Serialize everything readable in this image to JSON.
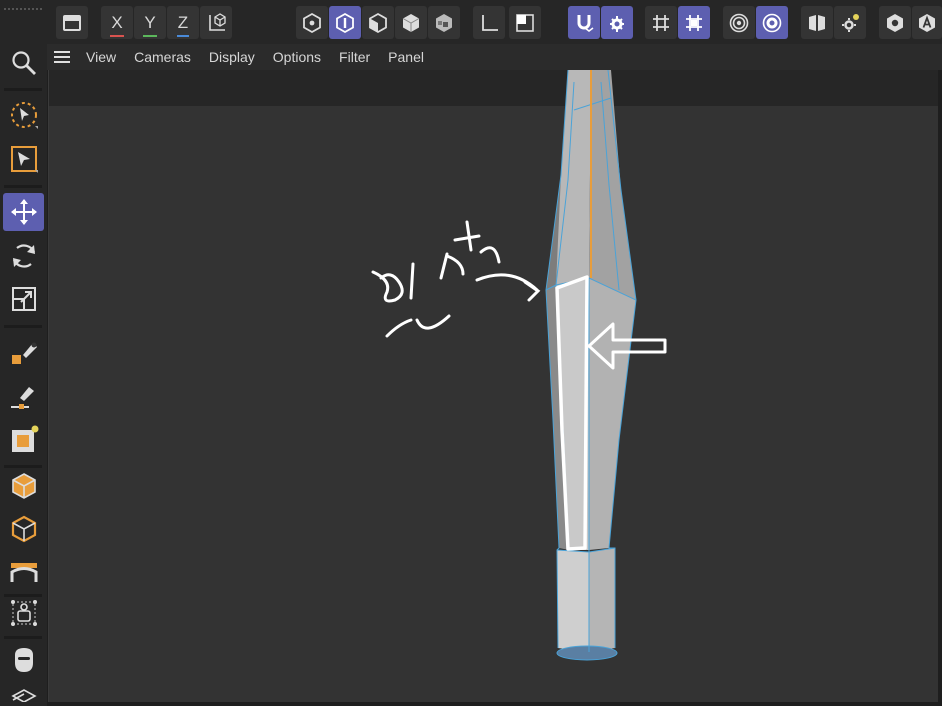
{
  "menu": {
    "items": [
      "View",
      "Cameras",
      "Display",
      "Options",
      "Filter",
      "Panel"
    ]
  },
  "toolbar": {
    "axis_x": "X",
    "axis_y": "Y",
    "axis_z": "Z",
    "icons": [
      "render-view-icon",
      "lock-x-icon",
      "lock-y-icon",
      "lock-z-icon",
      "coordinate-system-icon",
      "points-mode-icon",
      "edges-mode-icon",
      "polygons-mode-icon",
      "model-mode-icon",
      "texture-mode-icon",
      "axis-mode-icon",
      "solo-icon",
      "snap-icon",
      "snap-settings-icon",
      "grid-icon",
      "workplane-snap-icon",
      "target-icon",
      "soft-selection-icon",
      "symmetry-icon",
      "symmetry-settings-icon",
      "hide-icon",
      "text-a-icon"
    ]
  },
  "left_tools": [
    "search-icon",
    "live-selection-icon",
    "render-region-icon",
    "move-icon",
    "rotate-icon",
    "scale-icon",
    "pen-icon",
    "sketch-icon",
    "spline-icon",
    "cube-icon",
    "cube-outline-icon",
    "bend-icon",
    "character-icon",
    "mask-icon",
    "layers-icon"
  ],
  "colors": {
    "active_tool": "#5d5fb0",
    "accent_orange": "#e89d3b",
    "edge_blue": "#4aa3d8",
    "viewport_bg": "#333333"
  },
  "annotation": {
    "handwritten_korean": "인서"
  }
}
